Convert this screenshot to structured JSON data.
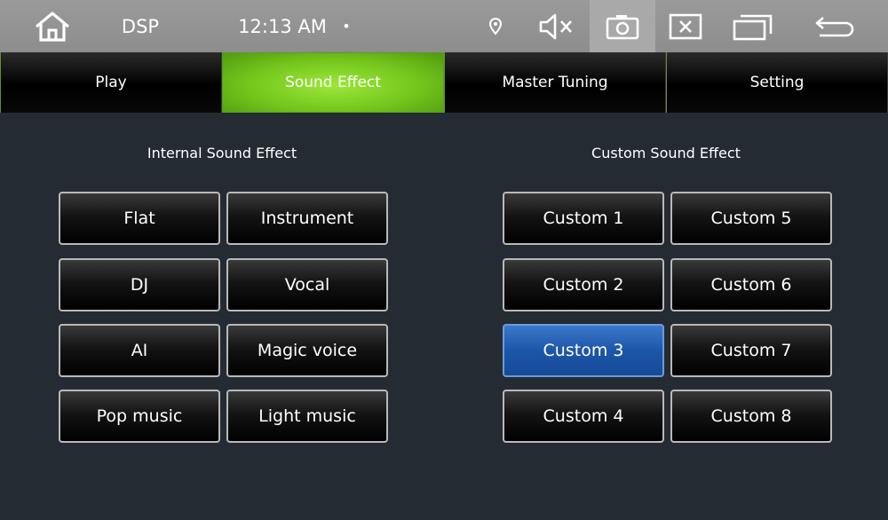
{
  "status_bar": {
    "app_title": "DSP",
    "time": "12:13 AM",
    "dot": "•",
    "icons": [
      "home-icon",
      "location-icon",
      "mute-icon",
      "camera-icon",
      "close-window-icon",
      "recent-apps-icon",
      "back-icon"
    ]
  },
  "tabs": [
    {
      "label": "Play",
      "active": false
    },
    {
      "label": "Sound Effect",
      "active": true
    },
    {
      "label": "Master Tuning",
      "active": false
    },
    {
      "label": "Setting",
      "active": false
    }
  ],
  "internal": {
    "heading": "Internal Sound Effect",
    "buttons": [
      "Flat",
      "Instrument",
      "DJ",
      "Vocal",
      "AI",
      "Magic voice",
      "Pop music",
      "Light music"
    ]
  },
  "custom": {
    "heading": "Custom Sound Effect",
    "buttons": [
      "Custom 1",
      "Custom 5",
      "Custom 2",
      "Custom 6",
      "Custom 3",
      "Custom 7",
      "Custom 4",
      "Custom 8"
    ],
    "selected": "Custom 3"
  },
  "colors": {
    "active_tab": "#74c61c",
    "selected_button": "#1d56a8",
    "background": "#252b33"
  }
}
